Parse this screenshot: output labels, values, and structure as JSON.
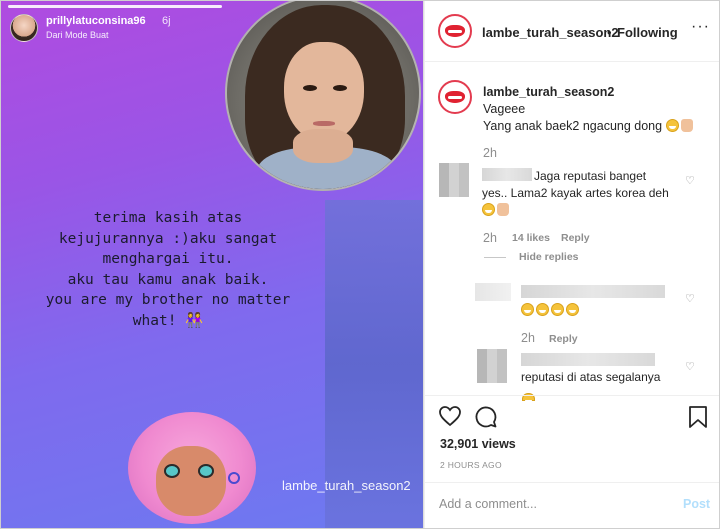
{
  "story": {
    "username": "prillylatuconsina96",
    "time": "6j",
    "subtitle": "Dari Mode Buat",
    "lines": [
      "terima kasih atas",
      "kejujurannya :)aku sangat",
      "menghargai itu.",
      "aku tau kamu anak baik.",
      "you are my brother no matter",
      "what! 👭"
    ],
    "watermark": "lambe_turah_season2"
  },
  "header": {
    "username": "lambe_turah_season2",
    "separator": "•",
    "follow_status": "Following",
    "more": "···"
  },
  "caption": {
    "username": "lambe_turah_season2",
    "dot": ".",
    "line1": "Vageee",
    "line2": "Yang anak baek2 ngacung dong"
  },
  "comments": [
    {
      "time": "2h",
      "text_visible": "Jaga reputasi banget",
      "text_line2": "yes.. Lama2 kayak artes korea deh",
      "likes": "14 likes",
      "reply": "Reply",
      "hide_replies": "Hide replies"
    },
    {
      "time": "2h",
      "reply": "Reply"
    },
    {
      "text": "reputasi di atas segalanya"
    }
  ],
  "footer": {
    "views": "32,901 views",
    "posted": "2 HOURS AGO",
    "add_comment_placeholder": "Add a comment...",
    "post_label": "Post"
  }
}
